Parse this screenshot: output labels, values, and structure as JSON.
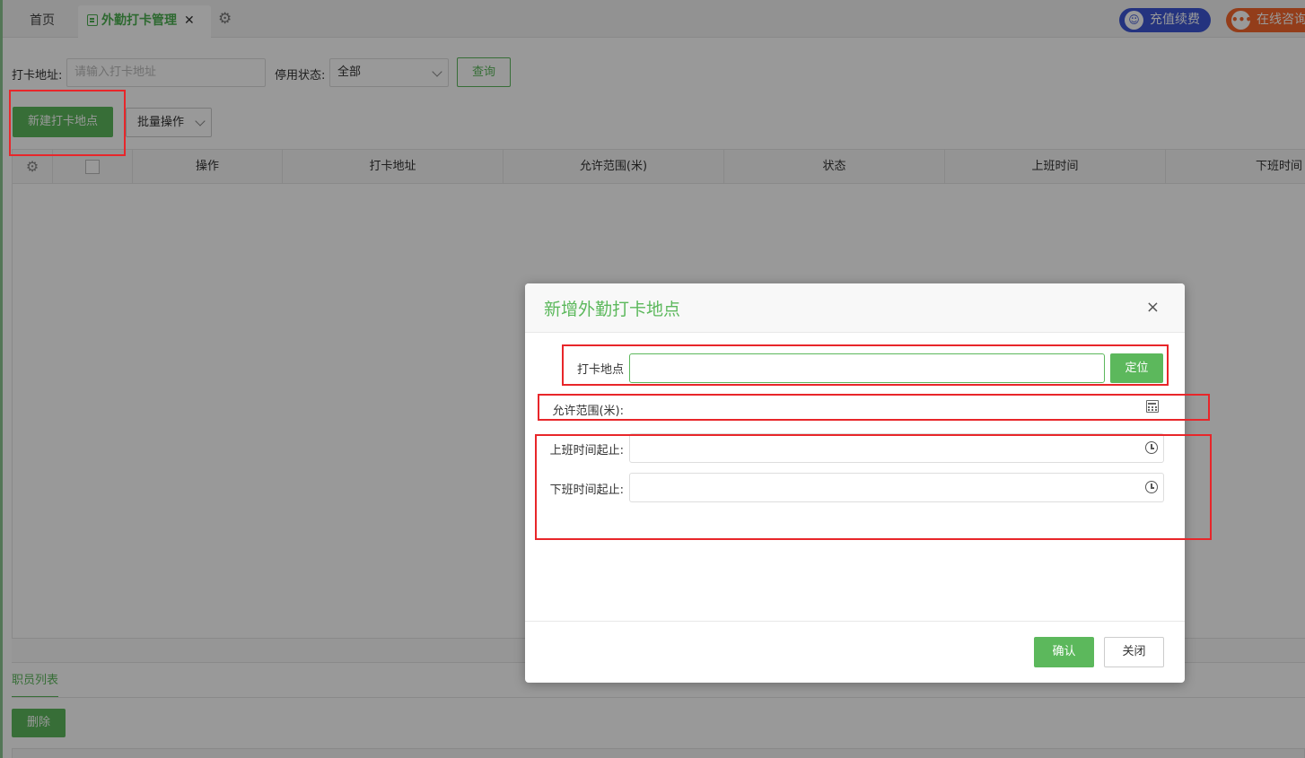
{
  "tabs": {
    "home": "首页",
    "active": "外勤打卡管理",
    "close": "✕",
    "gear": "⚙"
  },
  "header_actions": {
    "recharge": "充值续费",
    "consult": "在线咨询"
  },
  "filters": {
    "address_label": "打卡地址:",
    "address_placeholder": "请输入打卡地址",
    "status_label": "停用状态:",
    "status_value": "全部",
    "query": "查询"
  },
  "toolbar": {
    "new_location": "新建打卡地点",
    "batch": "批量操作"
  },
  "grid": {
    "columns": [
      "操作",
      "打卡地址",
      "允许范围(米)",
      "状态",
      "上班时间",
      "下班时间"
    ]
  },
  "employee": {
    "tab": "职员列表",
    "delete": "删除"
  },
  "modal": {
    "title": "新增外勤打卡地点",
    "close": "×",
    "location_label": "打卡地点",
    "locate": "定位",
    "range_label": "允许范围(米):",
    "work_start_label": "上班时间起止:",
    "work_end_label": "下班时间起止:",
    "confirm": "确认",
    "cancel": "关闭"
  },
  "colors": {
    "accent": "#5cb85c",
    "annotation": "#e8262a",
    "recharge": "#3d56d4",
    "consult": "#f5672c"
  },
  "icons": [
    "doc-icon",
    "gear-icon",
    "close-icon",
    "chevron-down-icon",
    "calculator-icon",
    "clock-icon",
    "user-icon",
    "chat-icon"
  ]
}
